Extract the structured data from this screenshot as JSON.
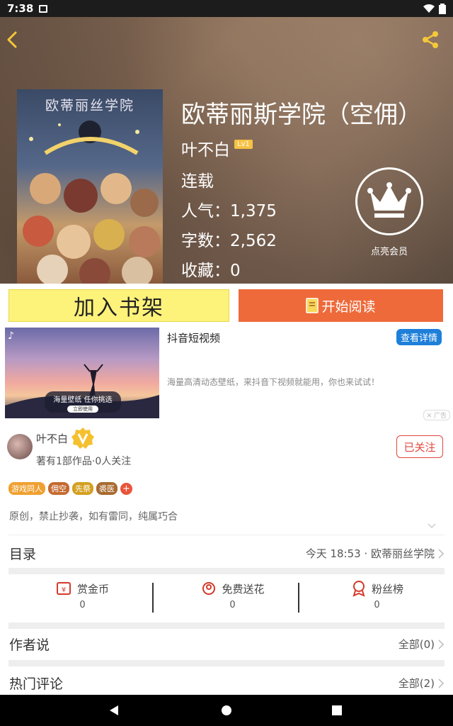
{
  "status_bar": {
    "time": "7:38"
  },
  "book": {
    "cover_title": "欧蒂丽丝学院",
    "title": "欧蒂丽斯学院（空佣）",
    "author": "叶不白",
    "author_level": "Lv1",
    "status": "连载",
    "popularity": "人气：1,375",
    "word_count": "字数：2,562",
    "favorites": "收藏：0",
    "vip_label": "点亮会员"
  },
  "actions": {
    "add_shelf": "加入书架",
    "start_read": "开始阅读"
  },
  "ad": {
    "title": "抖音短视频",
    "detail_button": "查看详情",
    "description": "海量高清动态壁纸，来抖音下视频就能用，你也来试试！",
    "overlay_text": "海量壁纸 任你挑选",
    "overlay_button": "立即使用",
    "ad_mark": "广告"
  },
  "author_section": {
    "name": "叶不白",
    "works": "著有1部作品·0人关注",
    "follow_button": "已关注",
    "tags": [
      {
        "label": "游戏同人",
        "color": "#f0a030"
      },
      {
        "label": "佣空",
        "color": "#c46a30"
      },
      {
        "label": "先祭",
        "color": "#d4a020"
      },
      {
        "label": "裘医",
        "color": "#a86a30"
      }
    ],
    "tag_add": "+",
    "description": "原创，禁止抄袭，如有雷同，纯属巧合"
  },
  "catalog": {
    "label": "目录",
    "latest": "今天 18:53 · 欧蒂丽丝学院"
  },
  "stats": [
    {
      "label": "赏金币",
      "value": "0",
      "icon": "reward-coin-icon"
    },
    {
      "label": "免费送花",
      "value": "0",
      "icon": "flower-icon"
    },
    {
      "label": "粉丝榜",
      "value": "0",
      "icon": "medal-icon"
    }
  ],
  "author_says": {
    "label": "作者说",
    "right": "全部(0)"
  },
  "hot_comments": {
    "label": "热门评论",
    "right": "全部(2)"
  },
  "colors": {
    "accent_orange": "#ee6a3a",
    "shelf_yellow": "#fdf27a",
    "follow_red": "#e0463c",
    "ad_blue": "#1e7fd9"
  }
}
